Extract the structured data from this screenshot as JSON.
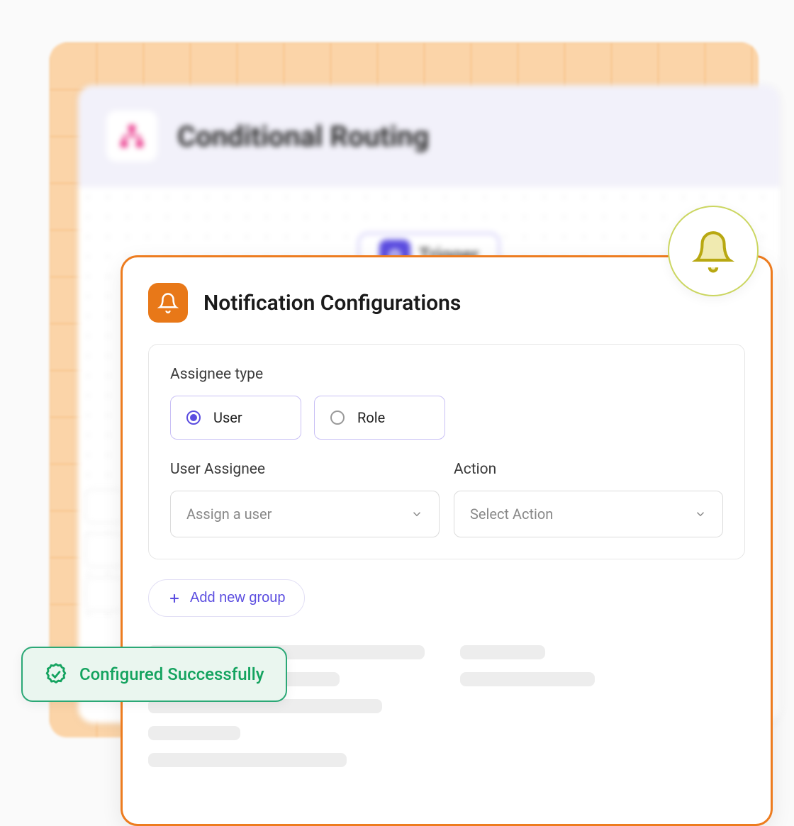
{
  "routing": {
    "title": "Conditional Routing",
    "trigger_label": "Trigger"
  },
  "notif": {
    "title": "Notification Configurations",
    "assignee_type_label": "Assignee type",
    "radio_user": "User",
    "radio_role": "Role",
    "user_assignee_label": "User Assignee",
    "user_assignee_placeholder": "Assign a user",
    "action_label": "Action",
    "action_placeholder": "Select Action",
    "add_group_label": "Add new group"
  },
  "toast": {
    "message": "Configured Successfully"
  },
  "colors": {
    "accent_orange": "#ed7c1f",
    "accent_purple": "#5b4de0",
    "success_green": "#14a35f"
  }
}
